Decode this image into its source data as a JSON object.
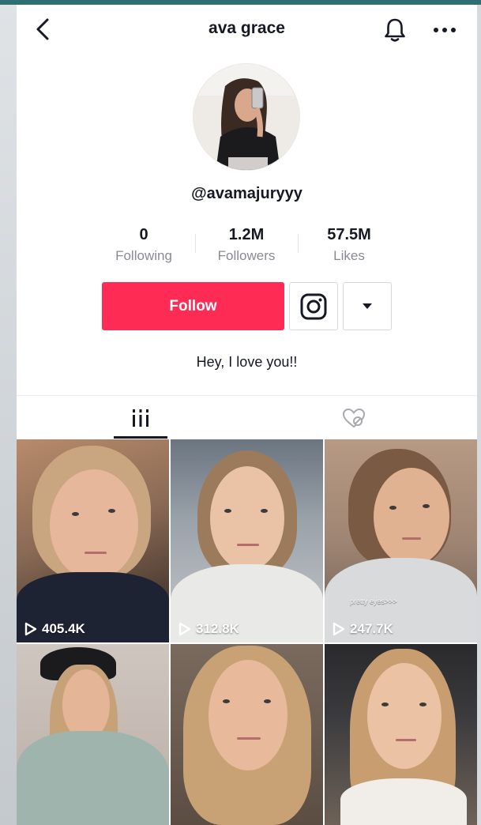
{
  "header": {
    "title": "ava grace",
    "back_icon": "chevron-left-icon",
    "bell_icon": "bell-icon",
    "more_icon": "more-horizontal-icon"
  },
  "profile": {
    "username": "@avamajuryyy",
    "bio": "Hey, I love you!!"
  },
  "stats": {
    "following": {
      "value": "0",
      "label": "Following"
    },
    "followers": {
      "value": "1.2M",
      "label": "Followers"
    },
    "likes": {
      "value": "57.5M",
      "label": "Likes"
    }
  },
  "actions": {
    "follow_label": "Follow",
    "instagram_icon": "instagram-icon",
    "dropdown_icon": "caret-down-icon"
  },
  "tabs": [
    {
      "name": "videos",
      "icon": "grid-icon",
      "active": true
    },
    {
      "name": "liked",
      "icon": "liked-hidden-icon",
      "active": false
    }
  ],
  "videos": [
    {
      "views": "405.4K",
      "caption": ""
    },
    {
      "views": "312.8K",
      "caption": ""
    },
    {
      "views": "247.7K",
      "caption": "pretty eyes>>>"
    },
    {
      "views": "",
      "caption": ""
    },
    {
      "views": "",
      "caption": ""
    },
    {
      "views": "",
      "caption": ""
    }
  ],
  "colors": {
    "accent": "#fe2c55",
    "text": "#161823",
    "muted": "#8a8b91"
  }
}
